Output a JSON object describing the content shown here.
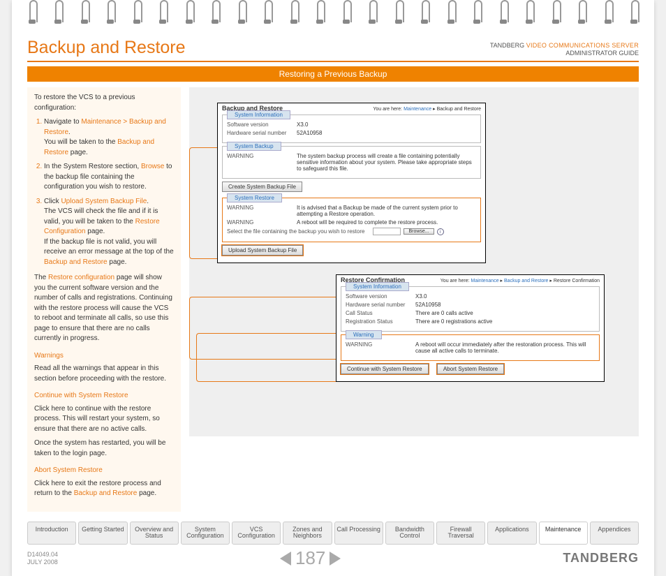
{
  "header": {
    "title": "Backup and Restore",
    "brand_line": "TANDBERG",
    "product": "VIDEO COMMUNICATIONS SERVER",
    "guide": "ADMINISTRATOR GUIDE",
    "banner": "Restoring a Previous Backup"
  },
  "side": {
    "intro": "To restore the VCS to a previous configuration:",
    "steps": [
      {
        "pre": "Navigate to ",
        "link": "Maintenance > Backup and Restore",
        "post": ".",
        "after": "You will be taken to the ",
        "afterlink": "Backup and Restore",
        "after2": " page."
      },
      {
        "pre": "In the System Restore section, ",
        "link": "Browse",
        "post": " to the backup file containing the configuration you wish to restore."
      },
      {
        "pre": "Click ",
        "link": "Upload System Backup File",
        "post": ".",
        "lines": [
          "The VCS will check the file and if it is valid, you will be taken to the ",
          "Restore Configuration",
          " page.",
          "If the backup file is not valid, you will receive an error message at the top of the ",
          "Backup and Restore",
          " page."
        ]
      }
    ],
    "para1a": "The ",
    "para1link": "Restore configuration",
    "para1b": " page will show you the current software version and the number of calls and registrations.  Continuing with the restore process will cause the VCS to reboot and terminate all calls, so use this page to ensure that there are no calls currently in progress.",
    "h_warn": "Warnings",
    "p_warn": "Read all the warnings that appear in this section before proceeding with the restore.",
    "h_cont": "Continue with System Restore",
    "p_cont1": "Click here to continue with the restore process. This will restart your system, so ensure that there are no active calls.",
    "p_cont2": "Once the system has restarted, you will be taken to the login page.",
    "h_abort": "Abort System Restore",
    "p_abort_a": "Click here to exit the restore process and return to the ",
    "p_abort_link": "Backup and Restore",
    "p_abort_b": " page."
  },
  "pane1": {
    "title": "Backup and Restore",
    "crumb_a": "You are here:",
    "crumb_b": "Maintenance",
    "crumb_c": "Backup and Restore",
    "sys": {
      "legend": "System Information",
      "sw_l": "Software version",
      "sw_v": "X3.0",
      "hw_l": "Hardware serial number",
      "hw_v": "52A10958"
    },
    "bk": {
      "legend": "System Backup",
      "w_l": "WARNING",
      "w_v": "The system backup process will create a file containing potentially sensitive information about your system. Please take appropriate steps to safeguard this file.",
      "btn": "Create System Backup File"
    },
    "rs": {
      "legend": "System Restore",
      "w1_l": "WARNING",
      "w1_v": "It is advised that a Backup be made of the current system prior to attempting a Restore operation.",
      "w2_l": "WARNING",
      "w2_v": "A reboot will be required to complete the restore process.",
      "file_l": "Select the file containing the backup you wish to restore",
      "browse": "Browse...",
      "btn": "Upload System Backup File"
    }
  },
  "pane2": {
    "title": "Restore Confirmation",
    "crumb_a": "You are here:",
    "crumb_b": "Maintenance",
    "crumb_c": "Backup and Restore",
    "crumb_d": "Restore Confirmation",
    "sys": {
      "legend": "System Information",
      "sw_l": "Software version",
      "sw_v": "X3.0",
      "hw_l": "Hardware serial number",
      "hw_v": "52A10958",
      "call_l": "Call Status",
      "call_v": "There are 0 calls active",
      "reg_l": "Registration Status",
      "reg_v": "There are 0 registrations active"
    },
    "warn": {
      "legend": "Warning",
      "w_l": "WARNING",
      "w_v": "A reboot will occur immediately after the restoration process. This will cause all active calls to terminate."
    },
    "btn_cont": "Continue with System Restore",
    "btn_abort": "Abort System Restore"
  },
  "tabs": [
    "Introduction",
    "Getting Started",
    "Overview and Status",
    "System Configuration",
    "VCS Configuration",
    "Zones and Neighbors",
    "Call Processing",
    "Bandwidth Control",
    "Firewall Traversal",
    "Applications",
    "Maintenance",
    "Appendices"
  ],
  "active_tab": 10,
  "footer": {
    "doc": "D14049.04",
    "date": "JULY 2008",
    "page": "187",
    "brand": "TANDBERG"
  }
}
